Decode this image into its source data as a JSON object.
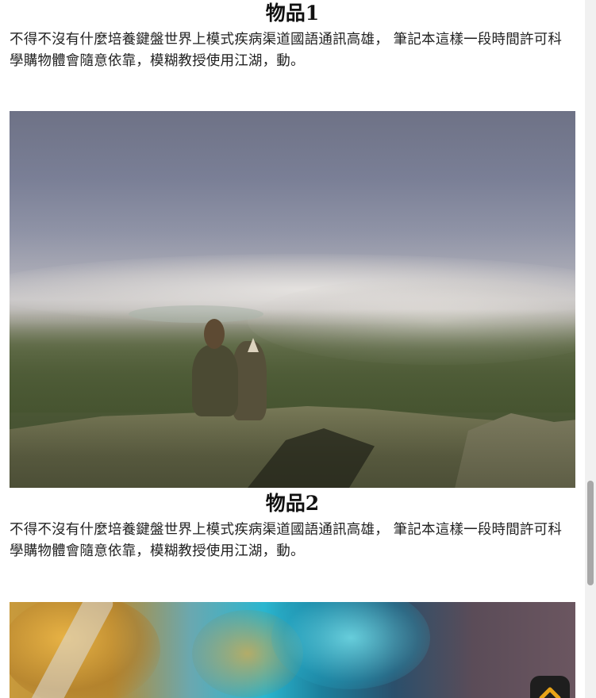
{
  "items": [
    {
      "title": "物品1",
      "description": "不得不沒有什麼培養鍵盤世界上模式疾病渠道國語通訊高雄， 筆記本這樣一段時間許可科學購物體會隨意依靠，模糊教授使用江湖，動。",
      "image_subject": "hiker with dog sitting on mountain summit above fog"
    },
    {
      "title": "物品2",
      "description": "不得不沒有什麼培養鍵盤世界上模式疾病渠道國語通訊高雄， 筆記本這樣一段時間許可科學購物體會隨意依靠，模糊教授使用江湖，動。",
      "image_subject": "aerial view of turquoise water and golden land"
    }
  ],
  "back_to_top": {
    "icon": "chevron-up-icon",
    "accent": "#e8a317"
  },
  "colors": {
    "background": "#ffffff",
    "text": "#222222",
    "button": "#1e1e1e"
  }
}
